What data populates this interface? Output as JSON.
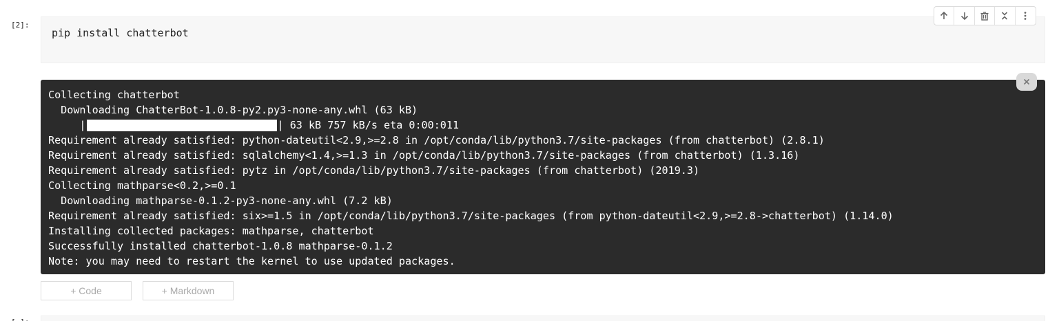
{
  "cell": {
    "prompt": "[2]:",
    "code": "pip install chatterbot"
  },
  "toolbar": {
    "icons": [
      "arrow-up-icon",
      "arrow-down-icon",
      "trash-icon",
      "collapse-icon",
      "more-vertical-icon"
    ]
  },
  "output": {
    "lines_before": [
      "Collecting chatterbot",
      "  Downloading ChatterBot-1.0.8-py2.py3-none-any.whl (63 kB)"
    ],
    "progress": {
      "prefix": "     |",
      "suffix": "| 63 kB 757 kB/s eta 0:00:011",
      "fraction": 1.0
    },
    "lines_after": [
      "Requirement already satisfied: python-dateutil<2.9,>=2.8 in /opt/conda/lib/python3.7/site-packages (from chatterbot) (2.8.1)",
      "Requirement already satisfied: sqlalchemy<1.4,>=1.3 in /opt/conda/lib/python3.7/site-packages (from chatterbot) (1.3.16)",
      "Requirement already satisfied: pytz in /opt/conda/lib/python3.7/site-packages (from chatterbot) (2019.3)",
      "Collecting mathparse<0.2,>=0.1",
      "  Downloading mathparse-0.1.2-py3-none-any.whl (7.2 kB)",
      "Requirement already satisfied: six>=1.5 in /opt/conda/lib/python3.7/site-packages (from python-dateutil<2.9,>=2.8->chatterbot) (1.14.0)",
      "Installing collected packages: mathparse, chatterbot",
      "Successfully installed chatterbot-1.0.8 mathparse-0.1.2",
      "Note: you may need to restart the kernel to use updated packages."
    ],
    "clear_icon": "close-icon",
    "background": "#2b2b2b",
    "text_color": "#ffffff"
  },
  "add_buttons": {
    "code_label": "+ Code",
    "markdown_label": "+ Markdown"
  },
  "next_cell": {
    "prompt": "[ ]:"
  }
}
